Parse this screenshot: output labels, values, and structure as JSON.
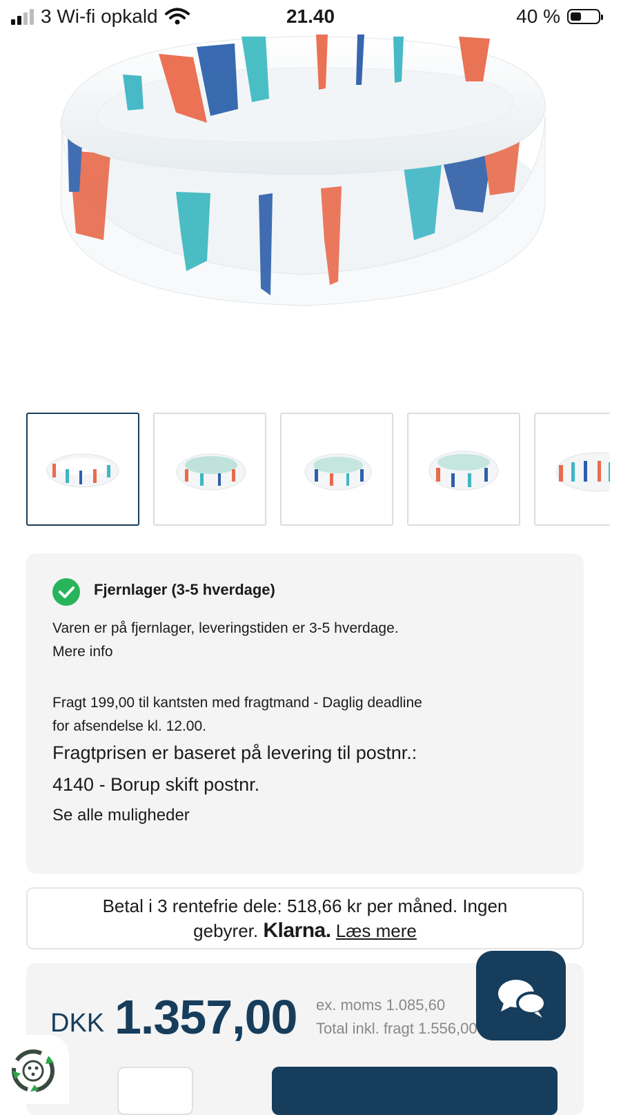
{
  "status_bar": {
    "carrier": "3 Wi-fi opkald",
    "time": "21.40",
    "battery_percent": "40 %",
    "battery_level": 0.4
  },
  "product_image": {
    "thumbnails": [
      {
        "label": "thumbnail-1",
        "active": true
      },
      {
        "label": "thumbnail-2",
        "active": false
      },
      {
        "label": "thumbnail-3",
        "active": false
      },
      {
        "label": "thumbnail-4",
        "active": false
      },
      {
        "label": "thumbnail-5",
        "active": false
      }
    ]
  },
  "stock": {
    "title": "Fjernlager (3-5 hverdage)",
    "description": "Varen er på fjernlager, leveringstiden er 3-5 hverdage.",
    "more_info": "Mere info",
    "shipping_line1": "Fragt 199,00 til kantsten med fragtmand - Daglig deadline",
    "shipping_line2": "for afsendelse kl. 12.00.",
    "postal_line1": "Fragtprisen er baseret på levering til postnr.:",
    "postal_line2": "4140 - Borup skift postnr.",
    "see_all": "Se alle muligheder",
    "status_color": "#27b45a"
  },
  "klarna": {
    "text_line1": "Betal i 3 rentefrie dele: 518,66 kr per måned. Ingen",
    "text_line2": "gebyrer.",
    "logo": "Klarna.",
    "read_more": "Læs mere"
  },
  "price": {
    "currency": "DKK",
    "amount": "1.357,00",
    "ex_vat": "ex. moms 1.085,60",
    "total_incl_shipping": "Total inkl. fragt 1.556,00",
    "accent_color": "#163d5c"
  },
  "icons": {
    "chat": "chat-bubbles-icon",
    "recycle": "recycle-icon",
    "check": "check-circle-icon"
  }
}
